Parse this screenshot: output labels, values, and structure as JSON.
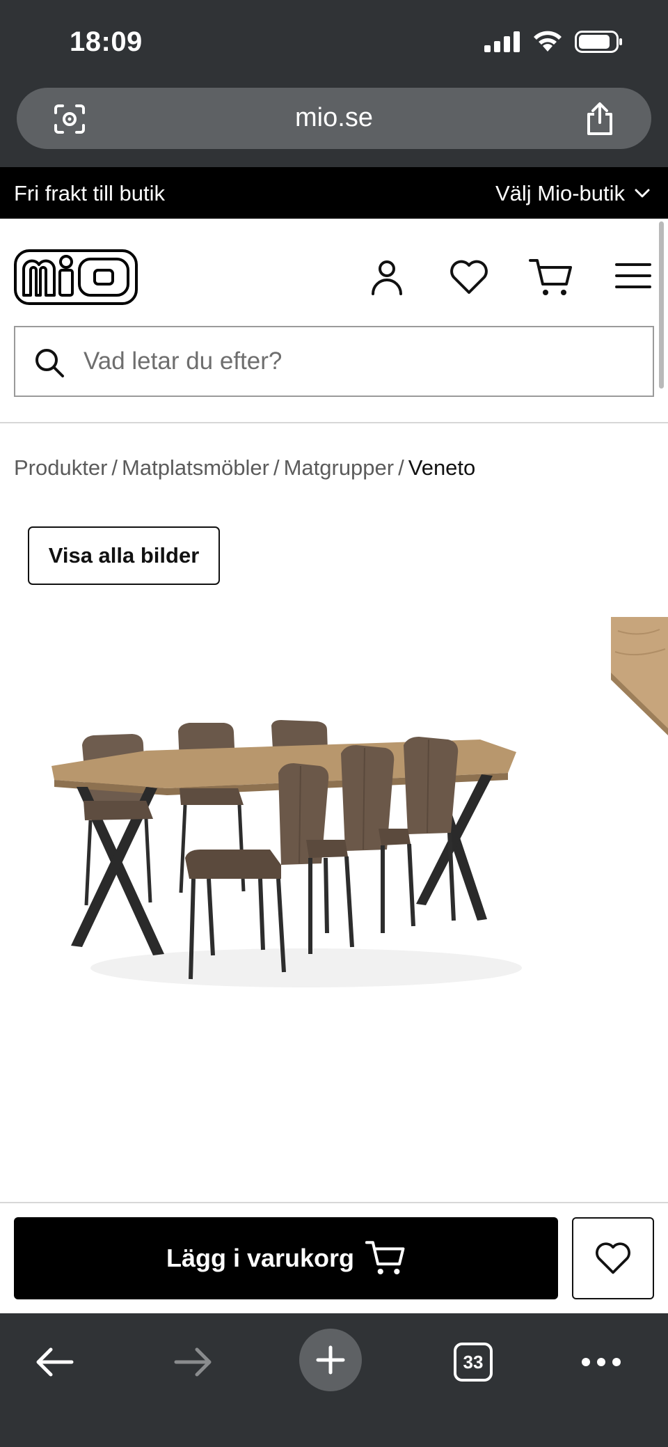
{
  "status_bar": {
    "time": "18:09",
    "icons": [
      "cellular-signal-icon",
      "wifi-icon",
      "battery-icon"
    ]
  },
  "browser": {
    "url": "mio.se",
    "tab_count": "33",
    "left_icon": "camera-search-icon",
    "right_icon": "share-icon"
  },
  "promo": {
    "left_text": "Fri frakt till butik",
    "right_text": "Välj Mio-butik"
  },
  "header": {
    "logo_text": "mio",
    "icons": [
      "account-icon",
      "heart-icon",
      "cart-icon",
      "menu-icon"
    ]
  },
  "search": {
    "placeholder": "Vad letar du efter?",
    "value": ""
  },
  "breadcrumb": {
    "items": [
      "Produkter",
      "Matplatsmöbler",
      "Matgrupper"
    ],
    "separator": "/",
    "current": "Veneto"
  },
  "gallery": {
    "show_all_label": "Visa alla bilder"
  },
  "cta": {
    "add_to_cart_label": "Lägg i varukorg"
  },
  "colors": {
    "browser_chrome": "#303336",
    "url_pill": "#5e6164",
    "promo_bar": "#000000",
    "cta_button": "#000000",
    "text": "#111111"
  }
}
